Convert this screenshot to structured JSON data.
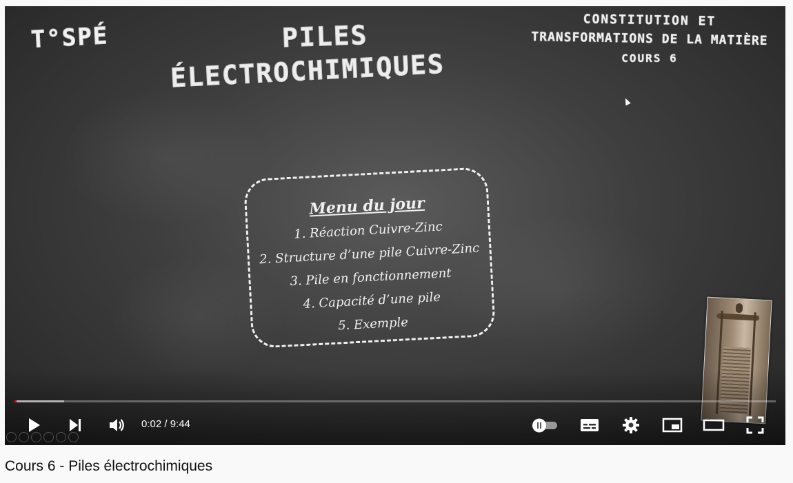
{
  "video": {
    "board": {
      "tag": "T°SPÉ",
      "title_line1": "PILES",
      "title_line2": "ÉLECTROCHIMIQUES",
      "section_line1": "CONSTITUTION ET",
      "section_line2": "TRANSFORMATIONS DE LA MATIÈRE",
      "section_line3": "COURS 6"
    },
    "menu": {
      "title": "Menu du jour",
      "items": [
        "1. Réaction Cuivre-Zinc",
        "2. Structure d’une pile Cuivre-Zinc",
        "3. Pile en fonctionnement",
        "4. Capacité d’une pile",
        "5. Exemple"
      ]
    }
  },
  "player": {
    "time": "0:02 / 9:44",
    "progress_played_fraction": 0.003,
    "progress_loaded_fraction": 0.065,
    "colors": {
      "progress_played": "#ff0000",
      "controls": "#ffffff"
    },
    "icons": {
      "play": "play-icon",
      "next": "next-icon",
      "volume": "volume-icon",
      "autoplay": "autoplay-toggle-icon",
      "subtitles": "subtitles-icon",
      "settings": "gear-icon",
      "miniplayer": "miniplayer-icon",
      "theater": "theater-icon",
      "fullscreen": "fullscreen-icon"
    }
  },
  "page": {
    "video_title": "Cours 6 - Piles électrochimiques"
  }
}
